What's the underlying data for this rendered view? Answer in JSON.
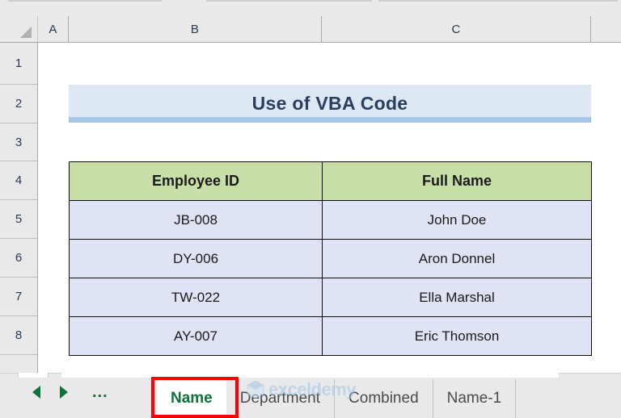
{
  "app": {
    "type": "spreadsheet",
    "colors": {
      "title_bg": "#dce9f5",
      "title_underline": "#a6c8e8",
      "header_bg": "#c7dfa6",
      "data_bg": "#dfe3f4",
      "active_tab_text": "#127041",
      "highlight_box": "#ff0000",
      "nav_arrow": "#12703c",
      "watermark": "#9cc3e8"
    }
  },
  "grid": {
    "column_headers": [
      "A",
      "B",
      "C",
      ""
    ],
    "row_headers": [
      "1",
      "2",
      "3",
      "4",
      "5",
      "6",
      "7",
      "8"
    ],
    "select_all_icon": "select-all-triangle-icon"
  },
  "title": {
    "text": "Use of VBA Code"
  },
  "table": {
    "headers": [
      "Employee ID",
      "Full Name"
    ],
    "rows": [
      {
        "employee_id": "JB-008",
        "full_name": "John Doe"
      },
      {
        "employee_id": "DY-006",
        "full_name": "Aron Donnel"
      },
      {
        "employee_id": "TW-022",
        "full_name": "Ella Marshal"
      },
      {
        "employee_id": "AY-007",
        "full_name": "Eric Thomson"
      }
    ]
  },
  "tab_bar": {
    "nav": {
      "prev_icon": "previous-sheet-arrow-icon",
      "next_icon": "next-sheet-arrow-icon",
      "overflow_label": "..."
    },
    "tabs": [
      {
        "label": "Name",
        "active": true
      },
      {
        "label": "Department",
        "active": false
      },
      {
        "label": "Combined",
        "active": false
      },
      {
        "label": "Name-1",
        "active": false
      }
    ]
  },
  "watermark": {
    "text": "exceldemy",
    "icon": "exceldemy-hexagon-logo-icon"
  }
}
